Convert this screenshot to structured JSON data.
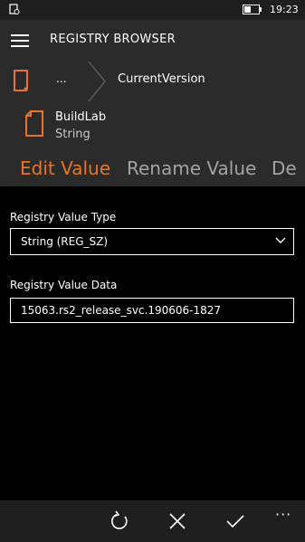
{
  "status": {
    "time": "19:23"
  },
  "app": {
    "title": "REGISTRY BROWSER"
  },
  "breadcrumb": {
    "ellipsis": "...",
    "current": "CurrentVersion"
  },
  "value": {
    "name": "BuildLab",
    "type": "String"
  },
  "tabs": [
    {
      "label": "Edit Value"
    },
    {
      "label": "Rename Value"
    },
    {
      "label": "De"
    }
  ],
  "form": {
    "type_label": "Registry Value Type",
    "type_selected": "String (REG_SZ)",
    "data_label": "Registry Value Data",
    "data_value": "15063.rs2_release_svc.190606-1827"
  },
  "colors": {
    "accent": "#e8742c",
    "header_bg": "#2b2b2b",
    "bar_bg": "#1f1f1f"
  },
  "appbar": {
    "icons": [
      "refresh-icon",
      "cancel-icon",
      "accept-icon"
    ],
    "more": "···"
  }
}
